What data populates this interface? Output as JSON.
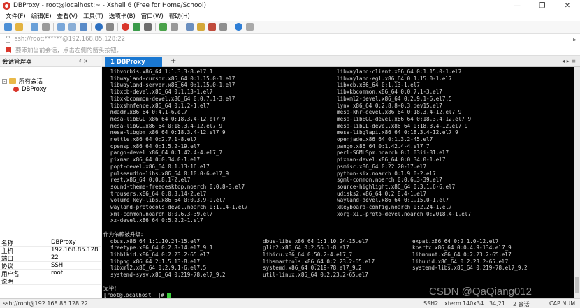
{
  "window": {
    "title": "DBProxy - root@localhost:~ - Xshell 6 (Free for Home/School)"
  },
  "window_controls": {
    "minimize": "—",
    "maximize": "❐",
    "close": "✕"
  },
  "menu": [
    "文件(F)",
    "编辑(E)",
    "查看(V)",
    "工具(T)",
    "选项卡(B)",
    "窗口(W)",
    "帮助(H)"
  ],
  "address": {
    "text": "ssh://root:******@192.168.85.128:22",
    "arrow": "▸"
  },
  "hint": {
    "text": "要添加当前会话，点击左侧的箭头按钮。"
  },
  "sidebar": {
    "title": "会话管理器",
    "pin": "♯ ×",
    "tree": {
      "root_toggle": "-",
      "root_label": "所有会话",
      "child_label": "DBProxy"
    },
    "properties": [
      {
        "k": "名称",
        "v": "DBProxy"
      },
      {
        "k": "主机",
        "v": "192.168.85.128"
      },
      {
        "k": "端口",
        "v": "22"
      },
      {
        "k": "协议",
        "v": "SSH"
      },
      {
        "k": "用户名",
        "v": "root"
      },
      {
        "k": "说明",
        "v": ""
      }
    ]
  },
  "tabs": {
    "active": "1 DBProxy",
    "add": "+",
    "nav": "◂ ▸ ≡"
  },
  "terminal": {
    "col1": [
      "libvorbis.x86_64 1:1.3.3-8.el7.1",
      "libwayland-cursor.x86_64 0:1.15.0-1.el7",
      "libwayland-server.x86_64 0:1.15.0-1.el7",
      "libxcb-devel.x86_64 0:1.13-1.el7",
      "libxkbcommon-devel.x86_64 0:0.7.1-3.el7",
      "libxshmfence.x86_64 0:1.2-1.el7",
      "mdadm.x86_64 0:4.1-6.el7",
      "mesa-libEGL.x86_64 0:18.3.4-12.el7_9",
      "mesa-libGL.x86_64 0:18.3.4-12.el7_9",
      "mesa-libgbm.x86_64 0:18.3.4-12.el7_9",
      "nettle.x86_64 0:2.7.1-8.el7",
      "opensp.x86_64 0:1.5.2-19.el7",
      "pango-devel.x86_64 0:1.42.4-4.el7_7",
      "pixman.x86_64 0:0.34.0-1.el7",
      "popt-devel.x86_64 0:1.13-16.el7",
      "pulseaudio-libs.x86_64 0:10.0-6.el7_9",
      "rest.x86_64 0:0.8.1-2.el7",
      "sound-theme-freedesktop.noarch 0:0.8-3.el7",
      "trousers.x86_64 0:0.3.14-2.el7",
      "volume_key-libs.x86_64 0:0.3.9-9.el7",
      "wayland-protocols-devel.noarch 0:1.14-1.el7",
      "xml-common.noarch 0:0.6.3-39.el7",
      "xz-devel.x86_64 0:5.2.2-1.el7"
    ],
    "col2": [
      "libwayland-client.x86_64 0:1.15.0-1.el7",
      "libwayland-egl.x86_64 0:1.15.0-1.el7",
      "libxcb.x86_64 0:1.13-1.el7",
      "libxkbcommon.x86_64 0:0.7.1-3.el7",
      "libxml2-devel.x86_64 0:2.9.1-6.el7.5",
      "lynx.x86_64 0:2.8.8-0.3.dev15.el7",
      "mesa-khr-devel.x86_64 0:18.3.4-12.el7_9",
      "mesa-libEGL-devel.x86_64 0:18.3.4-12.el7_9",
      "mesa-libGL-devel.x86_64 0:18.3.4-12.el7_9",
      "mesa-libglapi.x86_64 0:18.3.4-12.el7_9",
      "openjade.x86_64 0:1.3.2-45.el7",
      "pango.x86_64 0:1.42.4-4.el7_7",
      "perl-SGMLSpm.noarch 0:1.03ii-31.el7",
      "pixman-devel.x86_64 0:0.34.0-1.el7",
      "psmisc.x86_64 0:22.20-17.el7",
      "python-six.noarch 0:1.9.0-2.el7",
      "sgml-common.noarch 0:0.6.3-39.el7",
      "source-highlight.x86_64 0:3.1.6-6.el7",
      "udisks2.x86_64 0:2.8.4-1.el7",
      "wayland-devel.x86_64 0:1.15.0-1.el7",
      "xkeyboard-config.noarch 0:2.24-1.el7",
      "xorg-x11-proto-devel.noarch 0:2018.4-1.el7"
    ],
    "upgrade_title": "作为依赖被升级：",
    "upgrade_col1": [
      "dbus.x86_64 1:1.10.24-15.el7",
      "freetype.x86_64 0:2.8-14.el7_9.1",
      "libblkid.x86_64 0:2.23.2-65.el7",
      "libpng.x86_64 2:1.5.13-8.el7",
      "libxml2.x86_64 0:2.9.1-6.el7.5",
      "systemd-sysv.x86_64 0:219-78.el7_9.2"
    ],
    "upgrade_col2": [
      "dbus-libs.x86_64 1:1.10.24-15.el7",
      "glib2.x86_64 0:2.56.1-8.el7",
      "libicu.x86_64 0:50.2-4.el7_7",
      "libsmartcols.x86_64 0:2.23.2-65.el7",
      "systemd.x86_64 0:219-78.el7_9.2",
      "util-linux.x86_64 0:2.23.2-65.el7"
    ],
    "upgrade_col3": [
      "expat.x86_64 0:2.1.0-12.el7",
      "kpartx.x86_64 0:0.4.9-134.el7_9",
      "libmount.x86_64 0:2.23.2-65.el7",
      "libuuid.x86_64 0:2.23.2-65.el7",
      "systemd-libs.x86_64 0:219-78.el7_9.2"
    ],
    "done": "完毕！",
    "prompt": "[root@localhost ~]# "
  },
  "statusbar": {
    "conn": "ssh://root@192.168.85.128:22",
    "protocol": "SSH2",
    "term": "xterm",
    "size": "140x34",
    "pos": "34,21",
    "sessions": "2 会话",
    "cap": "CAP NUM"
  },
  "watermark": "CSDN @QaQiang012"
}
